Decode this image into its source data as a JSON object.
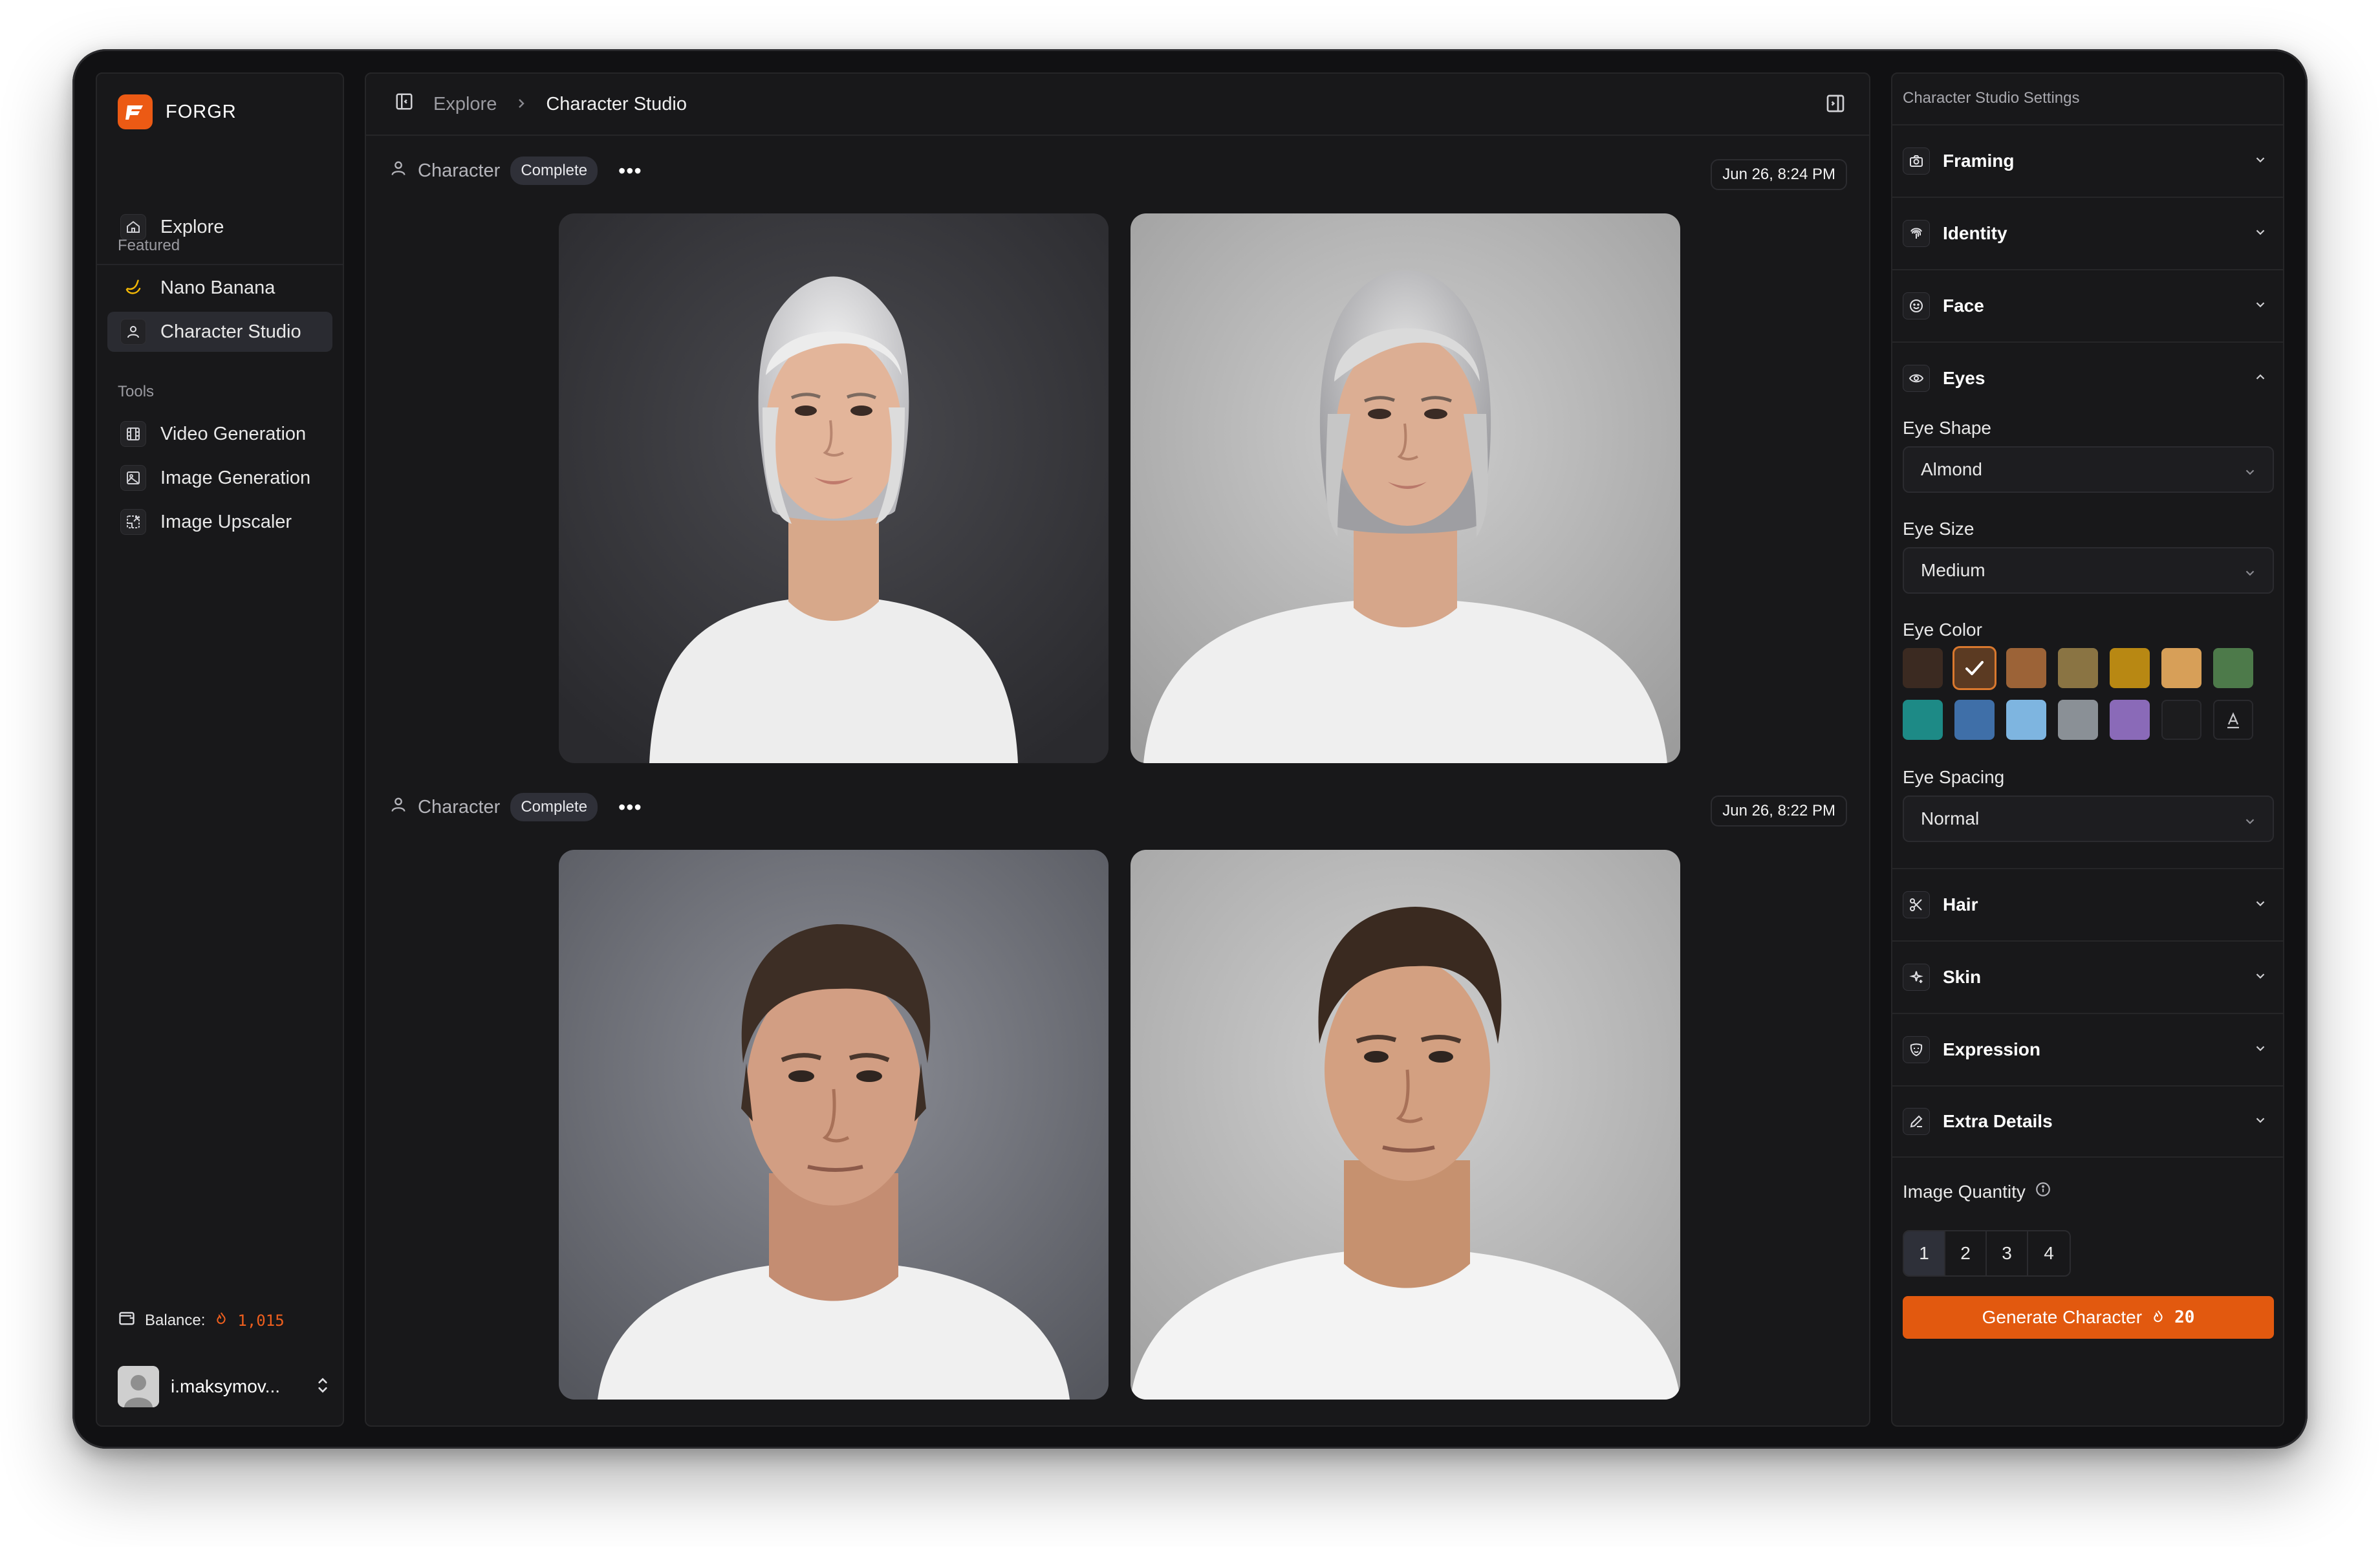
{
  "app": {
    "name": "FORGR"
  },
  "sidebar": {
    "explore": "Explore",
    "featured_label": "Featured",
    "featured": [
      {
        "label": "Nano Banana"
      },
      {
        "label": "Character Studio"
      }
    ],
    "tools_label": "Tools",
    "tools": [
      {
        "label": "Video Generation"
      },
      {
        "label": "Image Generation"
      },
      {
        "label": "Image Upscaler"
      }
    ],
    "balance_label": "Balance:",
    "balance_value": "1,015",
    "user_name": "i.maksymov..."
  },
  "breadcrumb": {
    "parent": "Explore",
    "current": "Character Studio"
  },
  "generations": [
    {
      "label": "Character",
      "status": "Complete",
      "timestamp": "Jun 26, 8:24 PM",
      "subject": "woman with short silver bob, white t-shirt"
    },
    {
      "label": "Character",
      "status": "Complete",
      "timestamp": "Jun 26, 8:22 PM",
      "subject": "man with short brown hair, white t-shirt"
    }
  ],
  "settings": {
    "title": "Character Studio Settings",
    "sections": {
      "framing": "Framing",
      "identity": "Identity",
      "face": "Face",
      "eyes": "Eyes",
      "hair": "Hair",
      "skin": "Skin",
      "expression": "Expression",
      "extra": "Extra Details"
    },
    "eye_shape_label": "Eye Shape",
    "eye_shape_value": "Almond",
    "eye_size_label": "Eye Size",
    "eye_size_value": "Medium",
    "eye_color_label": "Eye Color",
    "eye_colors": [
      "#3b2a21",
      "#5b3a22",
      "#9c6337",
      "#8a7443",
      "#b88813",
      "#d79f58",
      "#4d7a4a",
      "#1d8a86",
      "#3f6fa8",
      "#7eb5e0",
      "#8a9096",
      "#8a6ab8",
      "#1c1c1e"
    ],
    "eye_color_selected": 1,
    "eye_spacing_label": "Eye Spacing",
    "eye_spacing_value": "Normal",
    "image_quantity_label": "Image Quantity",
    "quantities": [
      "1",
      "2",
      "3",
      "4"
    ],
    "quantity_selected": "1",
    "generate_label": "Generate Character",
    "generate_cost": "20"
  },
  "colors": {
    "accent": "#e2590f",
    "background": "#111113",
    "panel": "#18181a"
  }
}
